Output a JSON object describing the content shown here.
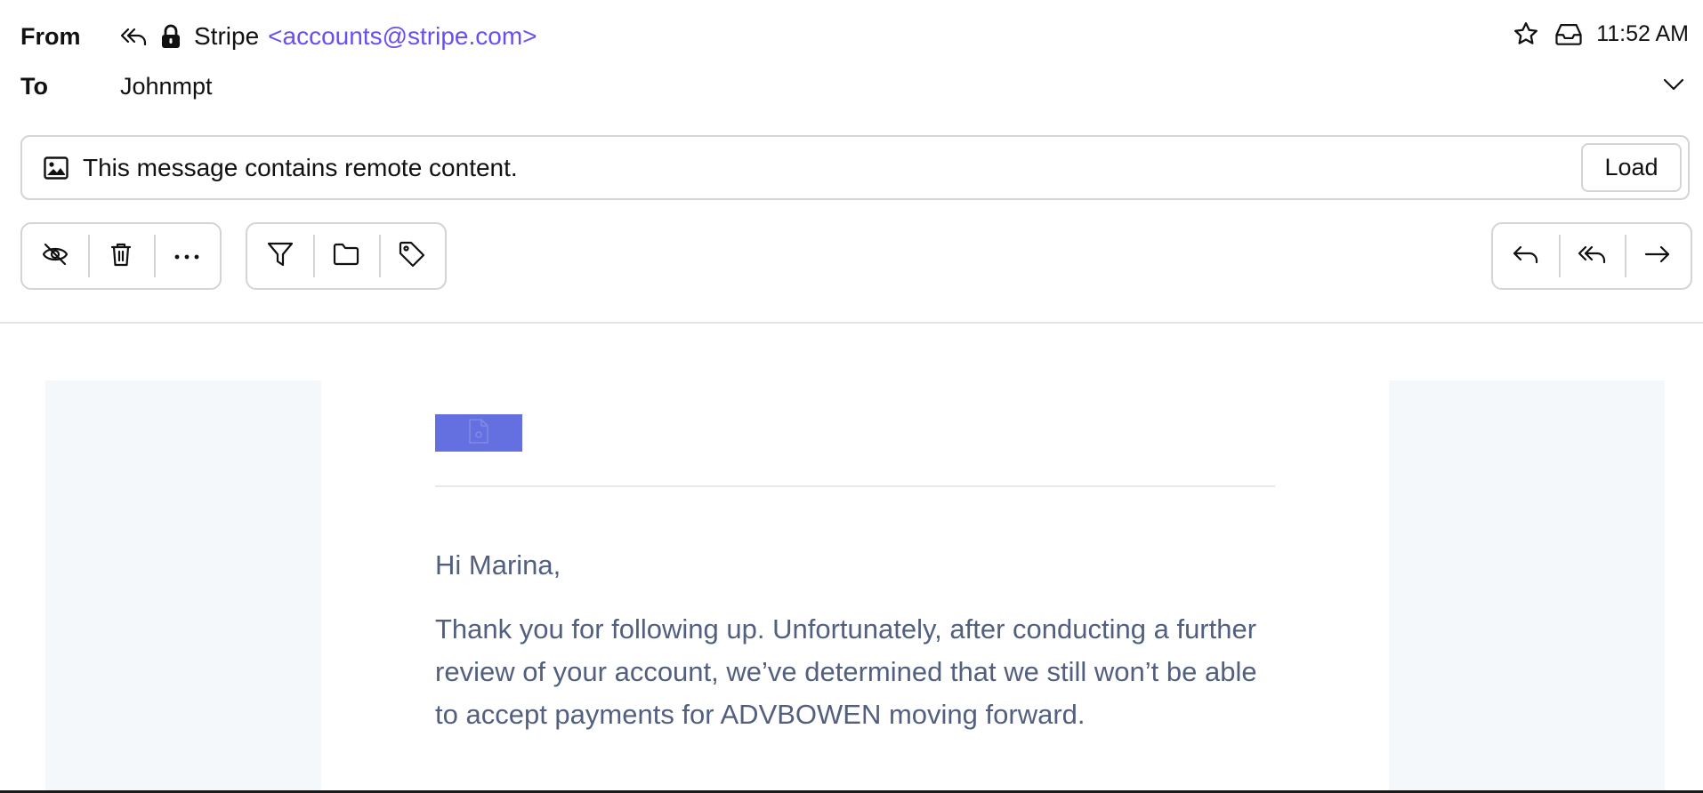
{
  "header": {
    "from_label": "From",
    "to_label": "To",
    "sender_name": "Stripe",
    "sender_email": "<accounts@stripe.com>",
    "recipient": "Johnmpt",
    "time": "11:52 AM"
  },
  "remote_content": {
    "message": "This message contains remote content.",
    "load_label": "Load"
  },
  "toolbar": {
    "left_group": [
      "eye-off-icon",
      "trash-icon",
      "more-icon"
    ],
    "middle_group": [
      "filter-icon",
      "folder-icon",
      "tag-icon"
    ],
    "right_group": [
      "reply-icon",
      "reply-all-icon",
      "forward-icon"
    ]
  },
  "email": {
    "greeting": "Hi Marina,",
    "body": "Thank you for following up. Unfortunately, after conducting a further review of your account, we’ve determined that we still won’t be able to accept payments for ADVBOWEN moving forward."
  },
  "colors": {
    "accent": "#6a4ff0",
    "logo_bg": "#6470df",
    "body_text": "#525f7f"
  }
}
